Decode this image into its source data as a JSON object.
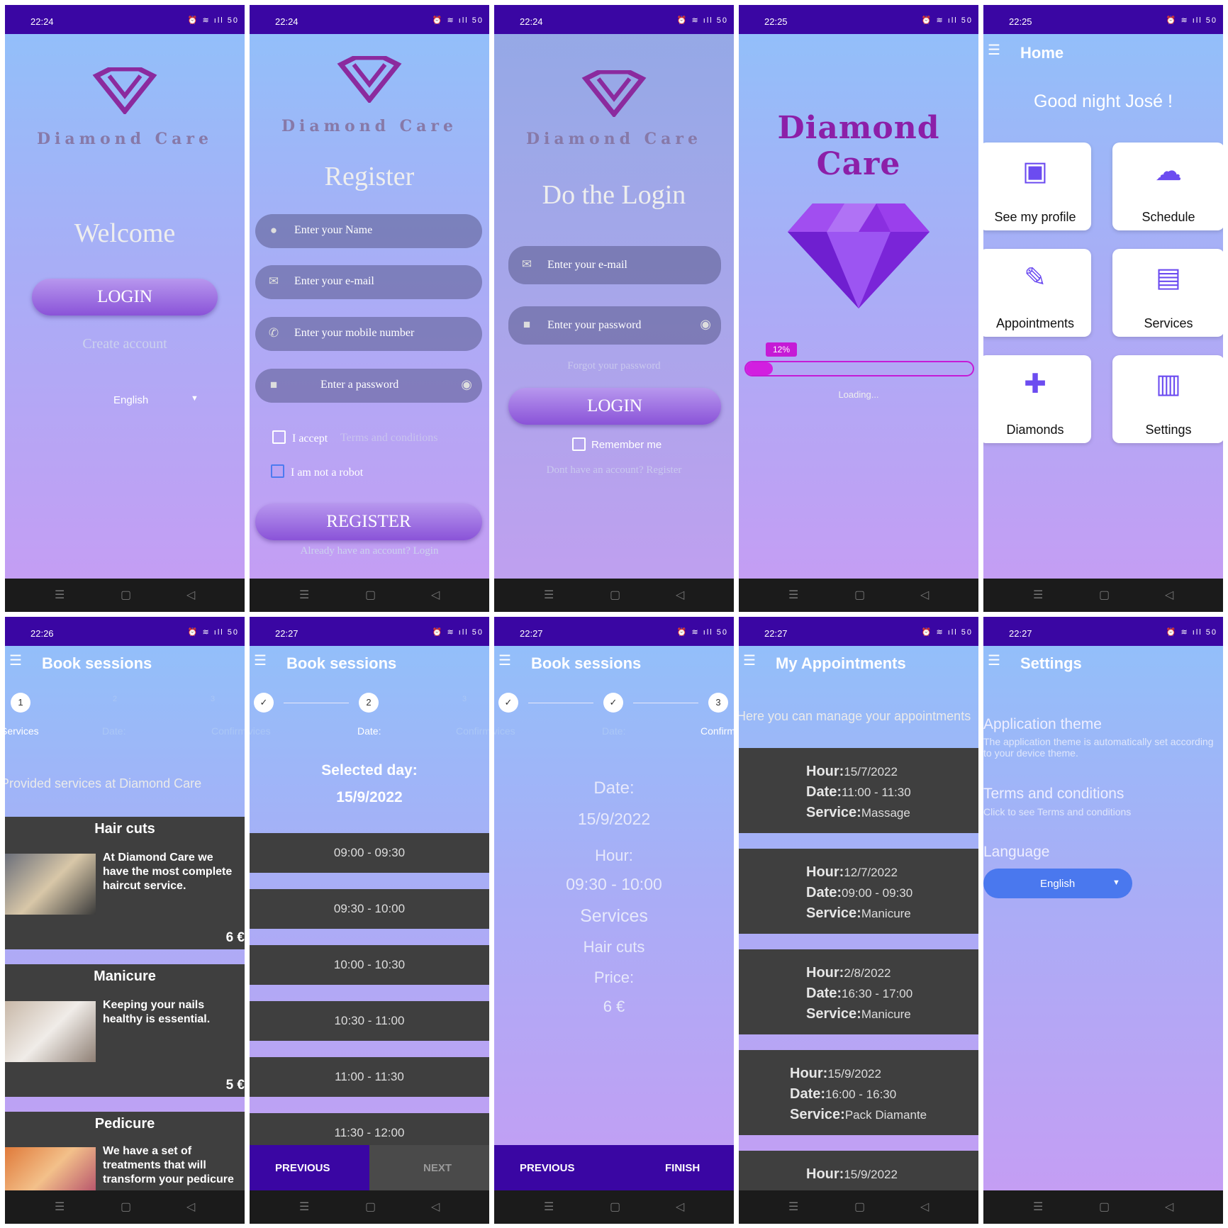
{
  "status": {
    "s1": "22:24",
    "s2": "22:24",
    "s3": "22:24",
    "s4": "22:25",
    "s5": "22:25",
    "s6": "22:26",
    "s7": "22:27",
    "s8": "22:27",
    "s9": "22:27",
    "s10": "22:27",
    "icons": "⏰ ≋ ıll 50"
  },
  "nav": {
    "menu": "☰",
    "home": "▢",
    "back": "◁"
  },
  "brand": {
    "name": "Diamond Care"
  },
  "welcome": {
    "title": "Welcome",
    "login": "LOGIN",
    "create": "Create account",
    "language": "English"
  },
  "register": {
    "title": "Register",
    "name_ph": "Enter your Name",
    "email_ph": "Enter your e-mail",
    "phone_ph": "Enter your mobile number",
    "pass_ph": "Enter a password",
    "accept": "I accept",
    "terms": "Terms and conditions",
    "robot": "I am not a robot",
    "button": "REGISTER",
    "login_link": "Already have an account? Login"
  },
  "login": {
    "title": "Do the Login",
    "email_ph": "Enter your e-mail",
    "pass_ph": "Enter your password",
    "forgot": "Forgot your password",
    "button": "LOGIN",
    "remember": "Remember me",
    "register_link": "Dont have an account? Register"
  },
  "splash": {
    "title": "Diamond Care",
    "progress": "12%",
    "progress_value": 0.12,
    "loading": "Loading..."
  },
  "home": {
    "title": "Home",
    "greeting": "Good night José !",
    "cards": [
      "See my profile",
      "Schedule",
      "Appointments",
      "Services",
      "Diamonds",
      "Settings"
    ]
  },
  "book": {
    "title": "Book sessions",
    "step1": "1",
    "step2": "2",
    "step3": "3",
    "lab1": "Services",
    "lab2": "Date:",
    "lab3": "Confirm",
    "intro": "Provided services at Diamond Care",
    "services": [
      {
        "name": "Hair cuts",
        "desc": "At Diamond Care we have the most complete haircut service.",
        "price": "6 €"
      },
      {
        "name": "Manicure",
        "desc": "Keeping your nails healthy is essential.",
        "price": "5 €"
      },
      {
        "name": "Pedicure",
        "desc": "We have a set of treatments that will transform your pedicure",
        "price": ""
      }
    ],
    "selected_label": "Selected day:",
    "selected_date": "15/9/2022",
    "slots": [
      "09:00 - 09:30",
      "09:30 - 10:00",
      "10:00 - 10:30",
      "10:30 - 11:00",
      "11:00 - 11:30",
      "11:30 - 12:00"
    ],
    "previous": "PREVIOUS",
    "next": "NEXT",
    "finish": "FINISH",
    "check": "✓",
    "confirm": {
      "date_label": "Date:",
      "date": "15/9/2022",
      "hour_label": "Hour:",
      "hour": "09:30 - 10:00",
      "services_label": "Services",
      "service": "Hair cuts",
      "price_label": "Price:",
      "price": "6 €"
    }
  },
  "appointments": {
    "title": "My Appointments",
    "intro": "Here you can manage your appointments",
    "hour_label": "Hour:",
    "date_label": "Date:",
    "service_label": "Service:",
    "items": [
      {
        "hour": "15/7/2022",
        "date": "11:00 - 11:30",
        "service": "Massage"
      },
      {
        "hour": "12/7/2022",
        "date": "09:00 - 09:30",
        "service": "Manicure"
      },
      {
        "hour": "2/8/2022",
        "date": "16:30 - 17:00",
        "service": "Manicure"
      },
      {
        "hour": "15/9/2022",
        "date": "16:00 - 16:30",
        "service": "Pack Diamante"
      },
      {
        "hour": "15/9/2022"
      }
    ]
  },
  "settings": {
    "title": "Settings",
    "theme": "Application theme",
    "theme_desc": "The application theme is automatically set according to your device theme.",
    "terms": "Terms and conditions",
    "terms_desc": "Click to see Terms and conditions",
    "language": "Language",
    "language_value": "English"
  },
  "colors": {
    "statusbar": "#3a06a3",
    "accent": "#8a53d8",
    "progress": "#d21fe0",
    "dark": "#3f3f3f",
    "lang_btn": "#4a78ee"
  }
}
